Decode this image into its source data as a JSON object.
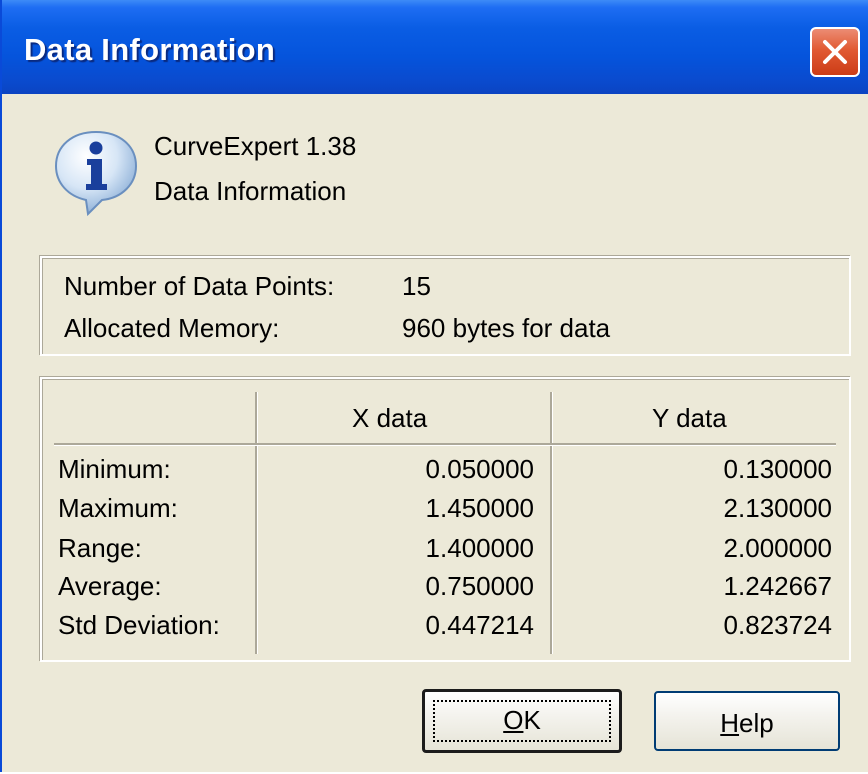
{
  "window": {
    "title": "Data Information"
  },
  "header": {
    "app_name": "CurveExpert 1.38",
    "subtitle": "Data Information",
    "icon": "info-icon"
  },
  "summary": {
    "points_label": "Number of Data Points:",
    "points_value": "15",
    "memory_label": "Allocated Memory:",
    "memory_value": "960 bytes for data"
  },
  "table": {
    "columns": [
      "",
      "X data",
      "Y data"
    ],
    "rows": [
      {
        "label": "Minimum:",
        "x": "0.050000",
        "y": "0.130000"
      },
      {
        "label": "Maximum:",
        "x": "1.450000",
        "y": "2.130000"
      },
      {
        "label": "Range:",
        "x": "1.400000",
        "y": "2.000000"
      },
      {
        "label": "Average:",
        "x": "0.750000",
        "y": "1.242667"
      },
      {
        "label": "Std Deviation:",
        "x": "0.447214",
        "y": "0.823724"
      }
    ]
  },
  "buttons": {
    "ok": {
      "mnemonic": "O",
      "rest": "K"
    },
    "help": {
      "mnemonic": "H",
      "rest": "elp"
    }
  },
  "colors": {
    "titlebar": "#0554dc",
    "dialog_bg": "#ece9d8",
    "close_button": "#e15a33"
  }
}
